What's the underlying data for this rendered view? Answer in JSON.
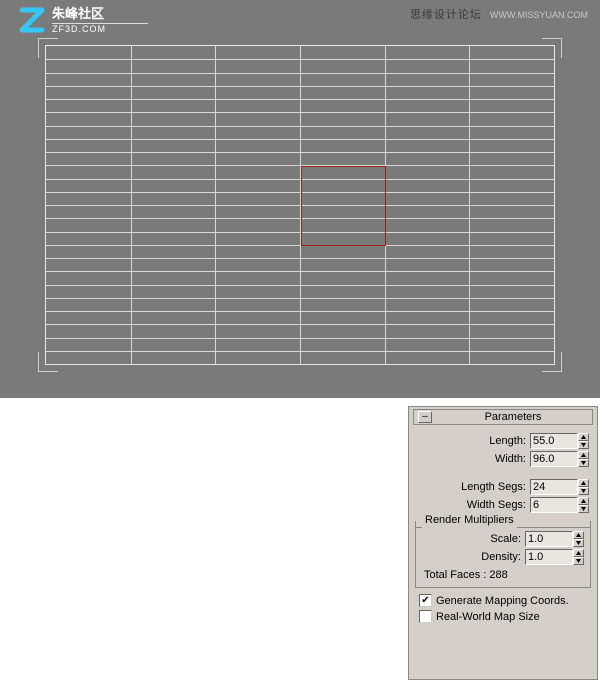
{
  "watermark": {
    "main": "思缘设计论坛",
    "url": "WWW.MISSYUAN.COM"
  },
  "logo": {
    "title": "朱峰社区",
    "subtitle": "ZF3D.COM"
  },
  "panel": {
    "title": "Parameters",
    "collapse": "–",
    "length_label": "Length:",
    "length_value": "55.0",
    "width_label": "Width:",
    "width_value": "96.0",
    "lengthsegs_label": "Length Segs:",
    "lengthsegs_value": "24",
    "widthsegs_label": "Width Segs:",
    "widthsegs_value": "6",
    "render_legend": "Render Multipliers",
    "scale_label": "Scale:",
    "scale_value": "1.0",
    "density_label": "Density:",
    "density_value": "1.0",
    "total_faces": "Total Faces : 288",
    "gen_mapping": "Generate Mapping Coords.",
    "real_world": "Real-World Map Size"
  },
  "grid": {
    "width_segs": 6,
    "length_segs": 24
  },
  "checkmark": "✔"
}
